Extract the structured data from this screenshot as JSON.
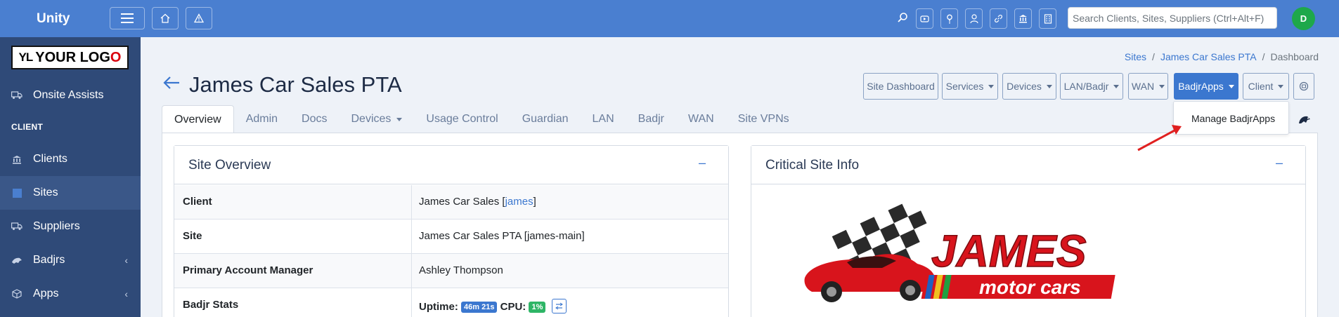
{
  "topbar": {
    "brand": "Unity",
    "search_placeholder": "Search Clients, Sites, Suppliers (Ctrl+Alt+F)",
    "avatar_initial": "D",
    "icons": [
      "menu-icon",
      "home-icon",
      "warning-icon",
      "search-icon",
      "video-icon",
      "help-icon",
      "user-icon",
      "link-icon",
      "bank-icon",
      "building-icon"
    ]
  },
  "sidebar": {
    "logo": {
      "prefix": "YL",
      "text_a": "YOUR LOG",
      "text_b": "O"
    },
    "heading": "CLIENT",
    "items": [
      {
        "label": "Onsite Assists",
        "icon": "truck-icon"
      },
      {
        "label": "Clients",
        "icon": "bank-icon"
      },
      {
        "label": "Sites",
        "icon": "building-icon",
        "active": true
      },
      {
        "label": "Suppliers",
        "icon": "truck-icon"
      },
      {
        "label": "Badjrs",
        "icon": "badger-icon",
        "chevron": "‹"
      },
      {
        "label": "Apps",
        "icon": "cube-icon",
        "chevron": "‹"
      }
    ]
  },
  "breadcrumb": {
    "sep": "/",
    "items": [
      "Sites",
      "James Car Sales PTA",
      "Dashboard"
    ]
  },
  "page": {
    "title": "James Car Sales PTA"
  },
  "header_buttons": {
    "site_dashboard": "Site Dashboard",
    "services": "Services",
    "devices": "Devices",
    "lan_badjr": "LAN/Badjr",
    "wan": "WAN",
    "badjrapps": "BadjrApps",
    "client": "Client"
  },
  "dropdown": {
    "item": "Manage BadjrApps"
  },
  "tabs": [
    "Overview",
    "Admin",
    "Docs",
    "Devices",
    "Usage Control",
    "Guardian",
    "LAN",
    "Badjr",
    "WAN",
    "Site VPNs"
  ],
  "site_overview": {
    "title": "Site Overview",
    "minimize": "–",
    "client_label": "Client",
    "client_value": "James Car Sales",
    "client_code": "james",
    "site_label": "Site",
    "site_value": "James Car Sales PTA [james-main]",
    "pam_label": "Primary Account Manager",
    "pam_value": "Ashley Thompson",
    "stats_label": "Badjr Stats",
    "uptime_label": "Uptime:",
    "uptime_value": "46m 21s",
    "cpu_label": "CPU:",
    "cpu_value": "1%"
  },
  "critical_info": {
    "title": "Critical Site Info",
    "minimize": "–",
    "logo_main": "JAMES",
    "logo_sub": "motor cars"
  },
  "colors": {
    "topbar": "#4a7fd0",
    "sidebar": "#2f4a78",
    "accent": "#3b77cf",
    "success": "#2eb566",
    "annotation_arrow": "#e02020"
  }
}
